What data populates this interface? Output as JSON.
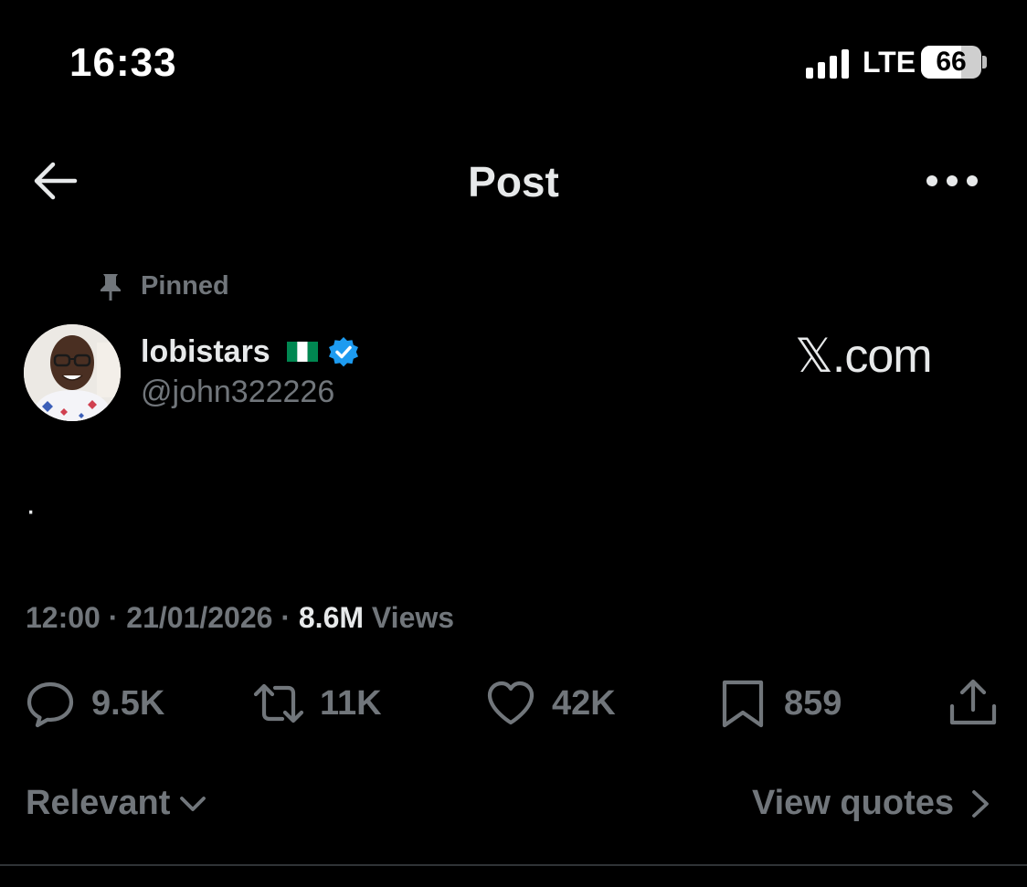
{
  "status_bar": {
    "time": "16:33",
    "network": "LTE",
    "battery": "66",
    "icons": [
      "signal-bars-icon",
      "battery-icon"
    ]
  },
  "header": {
    "title": "Post",
    "icons": [
      "back-arrow-icon",
      "more-options-icon"
    ]
  },
  "post": {
    "pinned_label": "Pinned",
    "author": {
      "display_name": "lobistars",
      "flag": "nigeria-flag-icon",
      "verified": "verified-badge-icon",
      "handle": "@john322226"
    },
    "watermark": "𝕏.com",
    "text": "·",
    "time": "12:00",
    "date": "21/01/2026",
    "views_count": "8.6M",
    "views_label": "Views",
    "separator": "·",
    "actions": {
      "replies": "9.5K",
      "reposts": "11K",
      "likes": "42K",
      "bookmarks": "859"
    }
  },
  "footer": {
    "sort_label": "Relevant",
    "view_quotes_label": "View quotes"
  },
  "colors": {
    "background": "#000000",
    "primary_text": "#e7e9ea",
    "secondary_text": "#71767b",
    "verified": "#1d9bf0",
    "divider": "#2f3336"
  }
}
